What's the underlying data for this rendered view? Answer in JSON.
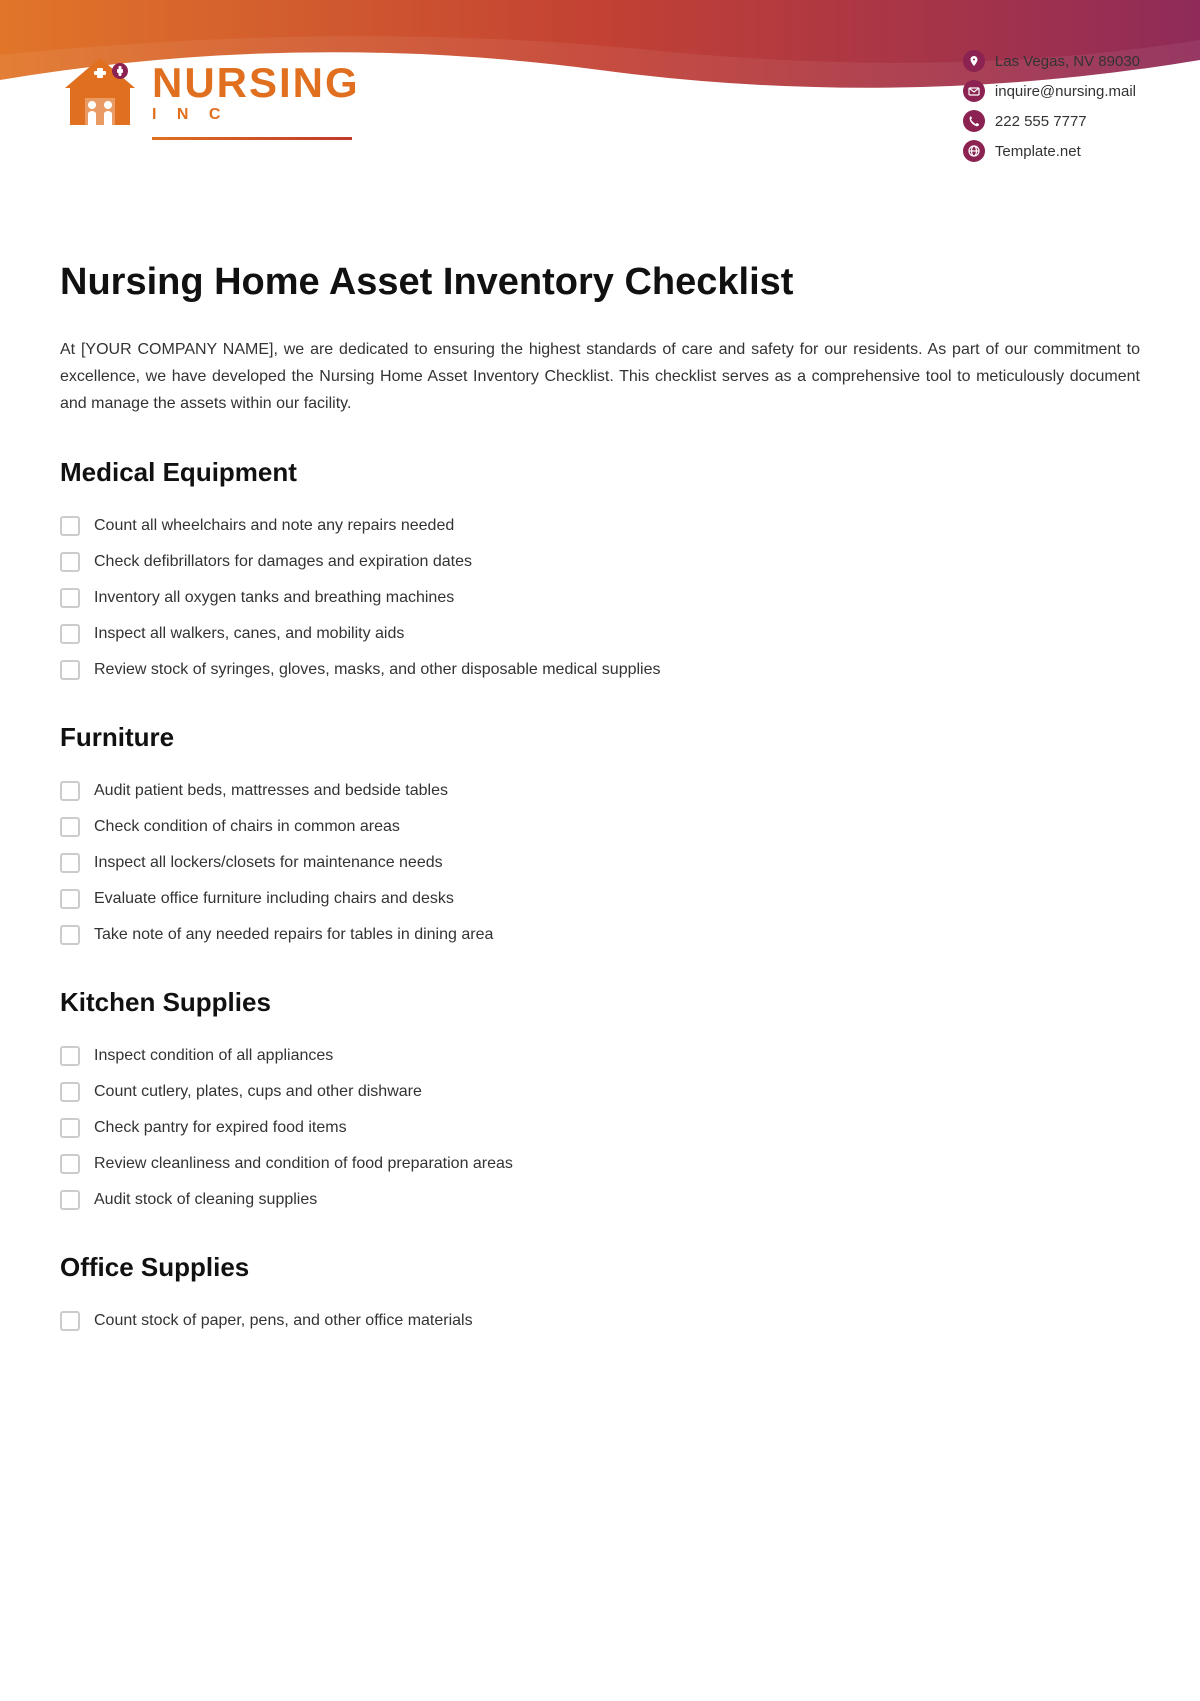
{
  "header": {
    "logo": {
      "nursing": "NURSING",
      "inc": "I N C"
    },
    "contact": {
      "address": "Las Vegas, NV 89030",
      "email": "inquire@nursing.mail",
      "phone": "222 555 7777",
      "website": "Template.net"
    }
  },
  "document": {
    "title": "Nursing Home Asset Inventory Checklist",
    "intro": "At [YOUR COMPANY NAME], we are dedicated to ensuring the highest standards of care and safety for our residents. As part of our commitment to excellence, we have developed the Nursing Home Asset Inventory Checklist. This checklist serves as a comprehensive tool to meticulously document and manage the assets within our facility."
  },
  "sections": [
    {
      "id": "medical-equipment",
      "title": "Medical Equipment",
      "items": [
        "Count all wheelchairs and note any repairs needed",
        "Check defibrillators for damages and expiration dates",
        "Inventory all oxygen tanks and breathing machines",
        "Inspect all walkers, canes, and mobility aids",
        "Review stock of syringes, gloves, masks, and other disposable medical supplies"
      ]
    },
    {
      "id": "furniture",
      "title": "Furniture",
      "items": [
        "Audit patient beds, mattresses and bedside tables",
        "Check condition of chairs in common areas",
        "Inspect all lockers/closets for maintenance needs",
        "Evaluate office furniture including chairs and desks",
        "Take note of any needed repairs for tables in dining area"
      ]
    },
    {
      "id": "kitchen-supplies",
      "title": "Kitchen Supplies",
      "items": [
        "Inspect condition of all appliances",
        "Count cutlery, plates, cups and other dishware",
        "Check pantry for expired food items",
        "Review cleanliness and condition of food preparation areas",
        "Audit stock of cleaning supplies"
      ]
    },
    {
      "id": "office-supplies",
      "title": "Office Supplies",
      "items": [
        "Count stock of paper, pens, and other office materials"
      ]
    }
  ]
}
